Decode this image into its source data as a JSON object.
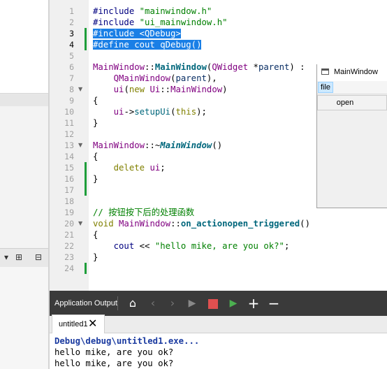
{
  "editor": {
    "line_numbers": [
      "1",
      "2",
      "3",
      "4",
      "5",
      "6",
      "7",
      "8",
      "9",
      "10",
      "11",
      "12",
      "13",
      "14",
      "15",
      "16",
      "17",
      "18",
      "19",
      "20",
      "21",
      "22",
      "23",
      "24"
    ],
    "lines": {
      "l1_kw": "#include",
      "l1_str": "\"mainwindow.h\"",
      "l2_kw": "#include",
      "l2_str": "\"ui_mainwindow.h\"",
      "l3": "#include <QDebug>",
      "l4": "#define cout qDebug()",
      "l6_cls": "MainWindow",
      "l6_sep": "::",
      "l6_fn": "MainWindow",
      "l6_open": "(",
      "l6_type": "QWidget",
      "l6_ptr": " *",
      "l6_param": "parent",
      "l6_close": ") :",
      "l7_cls": "QMainWindow",
      "l7_open": "(",
      "l7_param": "parent",
      "l7_close": "),",
      "l8_member": "ui",
      "l8_open": "(",
      "l8_new": "new",
      "l8_ns": "Ui",
      "l8_sep": "::",
      "l8_cls": "MainWindow",
      "l8_close": ")",
      "l9": "{",
      "l10_member": "ui",
      "l10_arrow": "->",
      "l10_fn": "setupUi",
      "l10_open": "(",
      "l10_this": "this",
      "l10_close": ");",
      "l11": "}",
      "l13_cls": "MainWindow",
      "l13_sep": "::~",
      "l13_fn": "MainWindow",
      "l13_close": "()",
      "l14": "{",
      "l15_del": "delete",
      "l15_member": "ui",
      "l15_semi": ";",
      "l16": "}",
      "l19_comment": "// 按钮按下后的处理函数",
      "l20_void": "void",
      "l20_cls": "MainWindow",
      "l20_sep": "::",
      "l20_fn": "on_actionopen_triggered",
      "l20_close": "()",
      "l21": "{",
      "l22_cout": "cout",
      "l22_op": "<<",
      "l22_str": "\"hello mike, are you ok?\"",
      "l22_semi": ";",
      "l23": "}"
    }
  },
  "preview": {
    "title": "MainWindow",
    "menu_file": "file",
    "menu_open": "open"
  },
  "output": {
    "title": "Application Output",
    "tab_label": "untitled1",
    "lines": [
      "Debug\\debug\\untitled1.exe...",
      "hello mike, are you ok?",
      "hello mike, are you ok?"
    ]
  },
  "colors": {
    "selection": "#1a7fe6",
    "changed_bar": "#1e9e3a",
    "output_toolbar": "#3a3a3a",
    "stop_button": "#e05050",
    "run_button": "#4caf50"
  },
  "icons": [
    "broom-icon",
    "prev-icon",
    "next-icon",
    "run-icon",
    "stop-icon",
    "debug-run-icon",
    "plus-icon",
    "minus-icon",
    "close-icon",
    "window-icon",
    "split-icon",
    "filter-icon",
    "dropdown-icon"
  ]
}
